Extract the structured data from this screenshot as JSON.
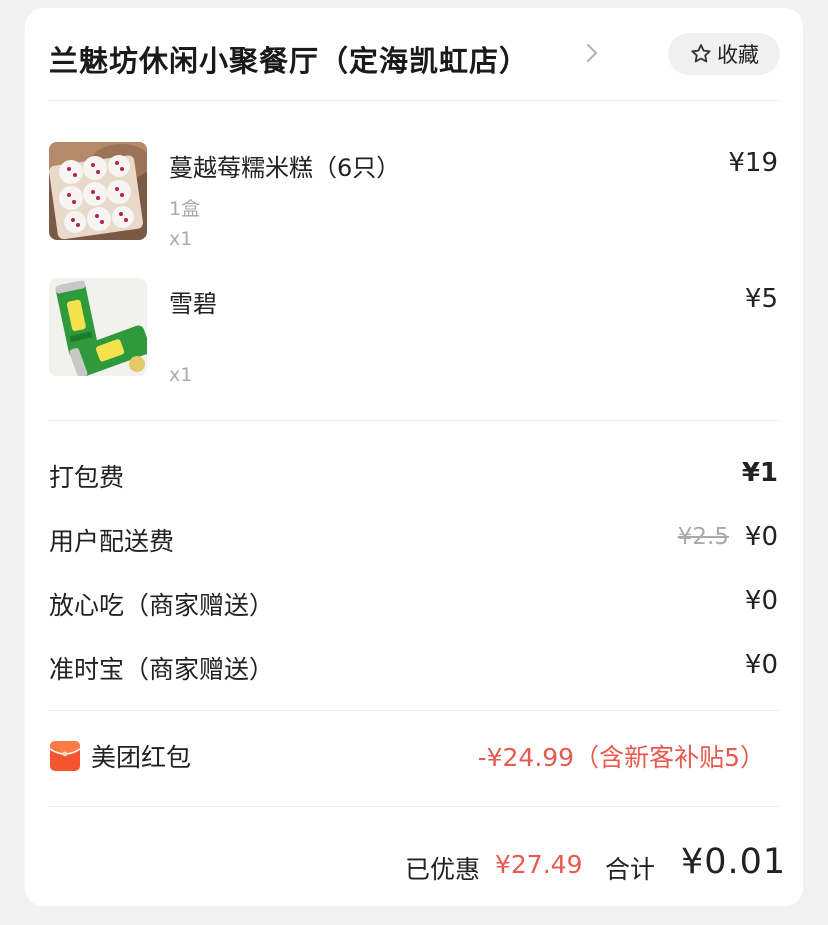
{
  "shop": {
    "name": "兰魅坊休闲小聚餐厅（定海凯虹店）",
    "favorite_label": "收藏"
  },
  "items": [
    {
      "name": "蔓越莓糯米糕（6只）",
      "spec": "1盒",
      "qty": "x1",
      "price": "¥19",
      "image": "rice-cake-photo"
    },
    {
      "name": "雪碧",
      "spec": "",
      "qty": "x1",
      "price": "¥5",
      "image": "sprite-can-photo"
    }
  ],
  "fees": [
    {
      "label": "打包费",
      "value": "¥1",
      "original": ""
    },
    {
      "label": "用户配送费",
      "value": "¥0",
      "original": "¥2.5"
    },
    {
      "label": "放心吃（商家赠送）",
      "value": "¥0",
      "original": ""
    },
    {
      "label": "准时宝（商家赠送）",
      "value": "¥0",
      "original": ""
    }
  ],
  "red_packet": {
    "label": "美团红包",
    "value": "-¥24.99（含新客补贴5）",
    "icon": "red-envelope-icon"
  },
  "summary": {
    "saved_label": "已优惠",
    "saved_value": "¥27.49",
    "total_label": "合计",
    "total_value": "¥0.01"
  },
  "colors": {
    "accent_red": "#e85a4f",
    "card_bg": "#ffffff",
    "page_bg": "#f2f2f2"
  }
}
